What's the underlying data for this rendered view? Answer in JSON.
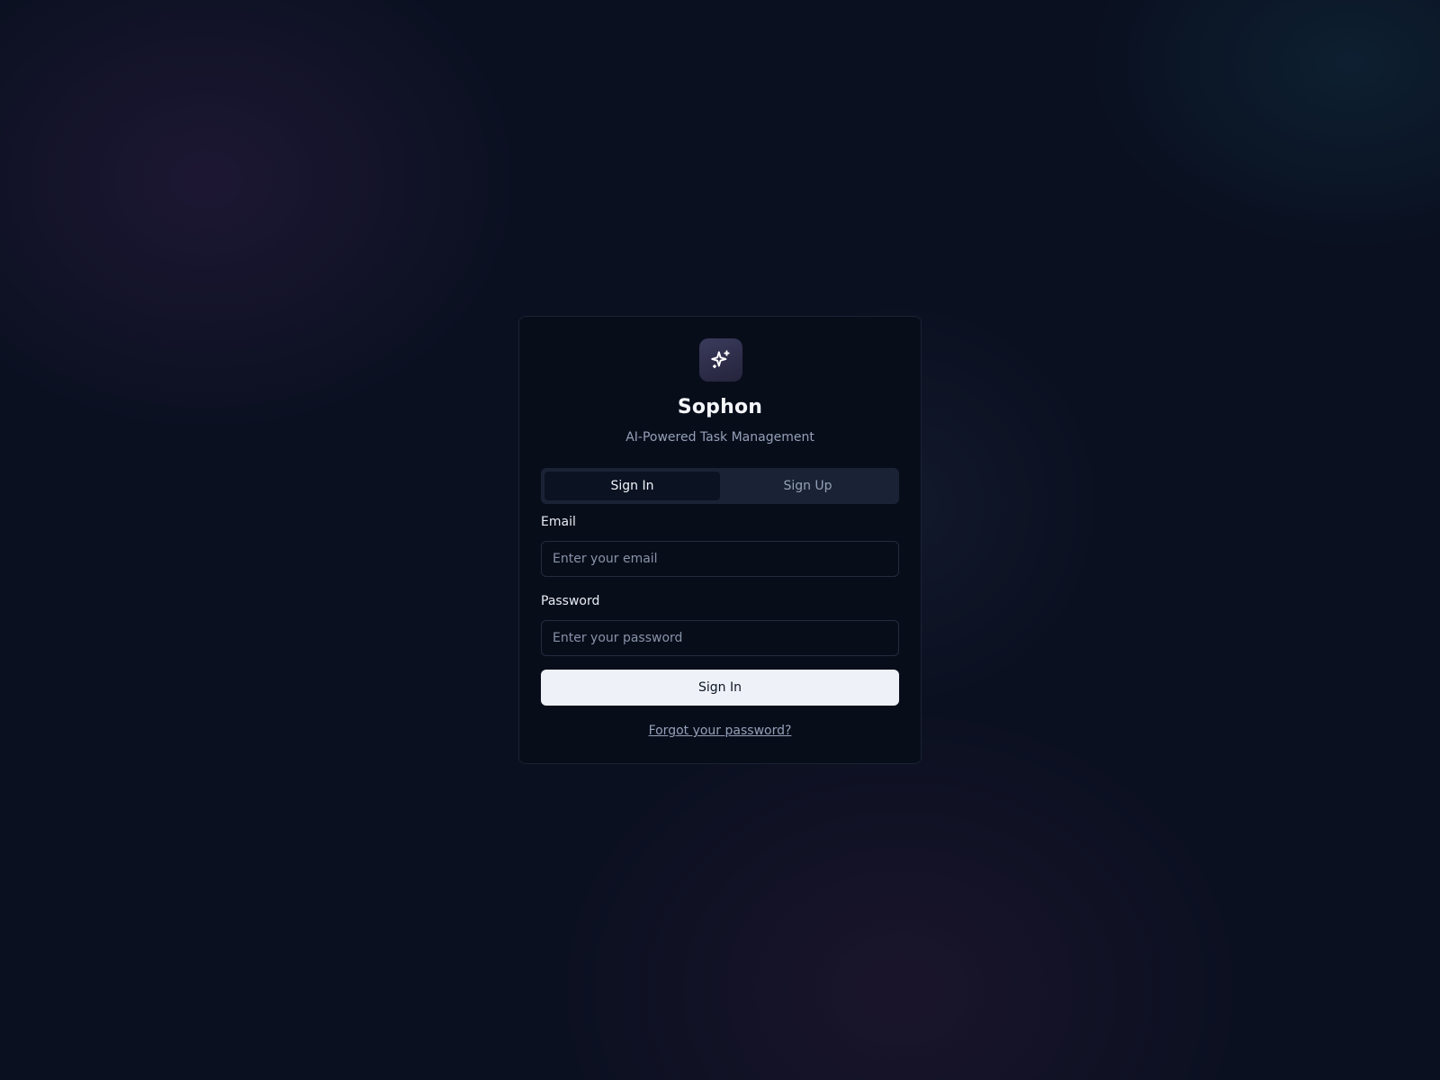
{
  "app": {
    "name": "Sophon",
    "tagline": "AI-Powered Task Management",
    "logo_icon": "sparkles-icon"
  },
  "tabs": [
    {
      "label": "Sign In",
      "active": true
    },
    {
      "label": "Sign Up",
      "active": false
    }
  ],
  "form": {
    "email": {
      "label": "Email",
      "placeholder": "Enter your email",
      "value": ""
    },
    "password": {
      "label": "Password",
      "placeholder": "Enter your password",
      "value": ""
    },
    "submit_label": "Sign In",
    "forgot_label": "Forgot your password?"
  },
  "colors": {
    "background": "#0a1020",
    "card": "#080d1a",
    "primary_button": "#eef2f8",
    "muted_text": "#94a0b8"
  }
}
